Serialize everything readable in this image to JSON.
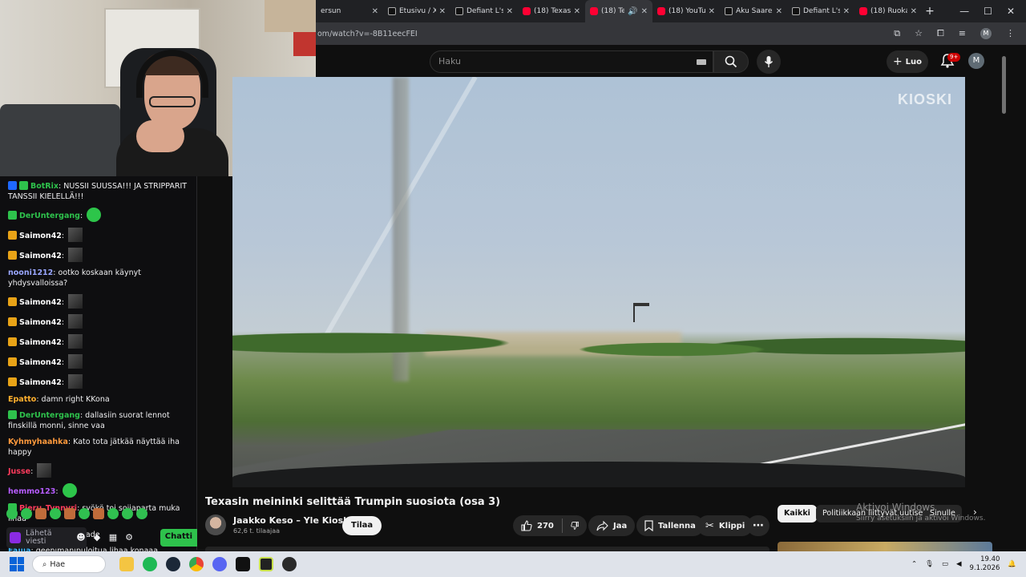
{
  "browser": {
    "tabs": [
      {
        "title": "ersun",
        "fav": "none"
      },
      {
        "title": "Etusivu / X",
        "fav": "x"
      },
      {
        "title": "Defiant L's",
        "fav": "x"
      },
      {
        "title": "(18) Texas",
        "fav": "yt"
      },
      {
        "title": "(18) Te",
        "fav": "yt",
        "active": true
      },
      {
        "title": "(18) YouTu",
        "fav": "yt"
      },
      {
        "title": "Aku Saare",
        "fav": "x"
      },
      {
        "title": "Defiant L's",
        "fav": "x"
      },
      {
        "title": "(18) Ruoka",
        "fav": "yt"
      }
    ],
    "url": "om/watch?v=-8B11eecFEI",
    "profile_initial": "M"
  },
  "youtube": {
    "search_placeholder": "Haku",
    "create_label": "Luo",
    "notifications_badge": "9+",
    "avatar_initial": "M",
    "watermark": "KIOSKI",
    "video_title": "Texasin meininki selittää Trumpin suosiota (osa 3)",
    "channel_name": "Jaakko Keso – Yle Kioski",
    "subscribers": "62,6 t. tilaajaa",
    "subscribe_label": "Tilaa",
    "like_count": "270",
    "share_label": "Jaa",
    "save_label": "Tallenna",
    "clip_label": "Klippi",
    "chips": {
      "all": "Kaikki",
      "politics": "Politiikkaan liittyvät uutiset",
      "you": "Sinulle"
    }
  },
  "windows_watermark": {
    "line1": "Aktivoi Windows",
    "line2": "Siirry asetuksiin ja aktivoi Windows."
  },
  "chat": {
    "messages": [
      {
        "user": "BotRix",
        "color": "#2ec24c",
        "text": "NUSSII SUUSSA!!! JA STRIPPARIT TANSSII KIELELLÄ!!!",
        "badges": [
          "#1f69ff",
          "#2ec24c"
        ]
      },
      {
        "user": "DerUntergang",
        "color": "#2ec24c",
        "text": "",
        "badges": [
          "#2ec24c"
        ],
        "emote": "green"
      },
      {
        "user": "Saimon42",
        "color": "#ffffff",
        "text": "",
        "badges": [
          "#e8a317"
        ],
        "emote": "img"
      },
      {
        "user": "Saimon42",
        "color": "#ffffff",
        "text": "",
        "badges": [
          "#e8a317"
        ],
        "emote": "img"
      },
      {
        "user": "nooni1212",
        "color": "#9aa7ff",
        "text": "ootko koskaan käynyt yhdysvalloissa?",
        "badges": []
      },
      {
        "user": "Saimon42",
        "color": "#ffffff",
        "text": "",
        "badges": [
          "#e8a317"
        ],
        "emote": "img"
      },
      {
        "user": "Saimon42",
        "color": "#ffffff",
        "text": "",
        "badges": [
          "#e8a317"
        ],
        "emote": "img"
      },
      {
        "user": "Saimon42",
        "color": "#ffffff",
        "text": "",
        "badges": [
          "#e8a317"
        ],
        "emote": "img"
      },
      {
        "user": "Saimon42",
        "color": "#ffffff",
        "text": "",
        "badges": [
          "#e8a317"
        ],
        "emote": "img"
      },
      {
        "user": "Saimon42",
        "color": "#ffffff",
        "text": "",
        "badges": [
          "#e8a317"
        ],
        "emote": "img"
      },
      {
        "user": "Epatto",
        "color": "#ffb02e",
        "text": "damn right KKona",
        "badges": []
      },
      {
        "user": "DerUntergang",
        "color": "#2ec24c",
        "text": "dallasiin suorat lennot finskillä monni, sinne vaa",
        "badges": [
          "#2ec24c"
        ]
      },
      {
        "user": "Kyhmyhaahka",
        "color": "#ff9a3c",
        "text": "Kato tota jätkää näyttää iha happy",
        "badges": []
      },
      {
        "user": "Jusse",
        "color": "#ff3b5c",
        "text": "",
        "badges": [],
        "emote": "img"
      },
      {
        "user": "hemmo123",
        "color": "#b65cff",
        "text": "",
        "badges": [],
        "emote": "green"
      },
      {
        "user": "Pieru_Tynnyri",
        "color": "#ff3b5c",
        "text": "syökö toi soijaparta muka lihaa",
        "badges": [
          "#2ec24c"
        ]
      },
      {
        "user": "Cerpander",
        "color": "#ffd34d",
        "text": "ootko kade",
        "badges": []
      },
      {
        "user": "Faijja",
        "color": "#3db8ff",
        "text": "geenimanipuloitua lihaa konaaa",
        "badges": []
      }
    ],
    "input_placeholder": "Lähetä viesti",
    "send_label": "Chatti"
  },
  "taskbar": {
    "search_label": "Hae",
    "time": "19.40",
    "date": "9.1.2026"
  }
}
